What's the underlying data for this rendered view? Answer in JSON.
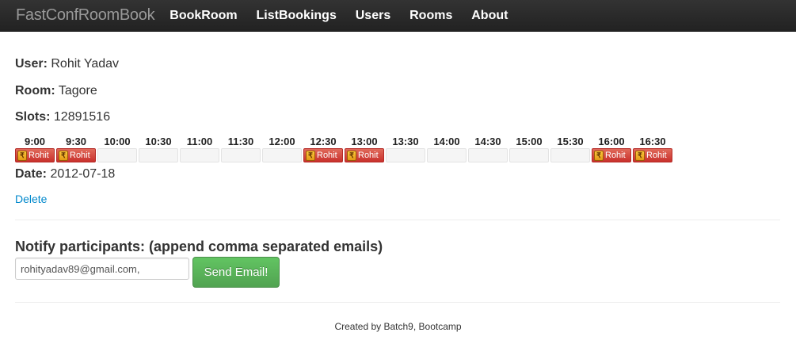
{
  "navbar": {
    "brand": "FastConfRoomBook",
    "items": [
      {
        "label": "BookRoom"
      },
      {
        "label": "ListBookings"
      },
      {
        "label": "Users"
      },
      {
        "label": "Rooms"
      },
      {
        "label": "About"
      }
    ]
  },
  "booking": {
    "user_label": "User:",
    "user_value": "Rohit Yadav",
    "room_label": "Room:",
    "room_value": "Tagore",
    "slots_label": "Slots:",
    "slots_value": "12891516",
    "date_label": "Date:",
    "date_value": "2012-07-18",
    "delete_label": "Delete"
  },
  "slots": [
    {
      "time": "9:00",
      "booked_by": "Rohit"
    },
    {
      "time": "9:30",
      "booked_by": "Rohit"
    },
    {
      "time": "10:00",
      "booked_by": ""
    },
    {
      "time": "10:30",
      "booked_by": ""
    },
    {
      "time": "11:00",
      "booked_by": ""
    },
    {
      "time": "11:30",
      "booked_by": ""
    },
    {
      "time": "12:00",
      "booked_by": ""
    },
    {
      "time": "12:30",
      "booked_by": "Rohit"
    },
    {
      "time": "13:00",
      "booked_by": "Rohit"
    },
    {
      "time": "13:30",
      "booked_by": ""
    },
    {
      "time": "14:00",
      "booked_by": ""
    },
    {
      "time": "14:30",
      "booked_by": ""
    },
    {
      "time": "15:00",
      "booked_by": ""
    },
    {
      "time": "15:30",
      "booked_by": ""
    },
    {
      "time": "16:00",
      "booked_by": "Rohit"
    },
    {
      "time": "16:30",
      "booked_by": "Rohit"
    }
  ],
  "notify": {
    "title": "Notify participants: (append comma separated emails)",
    "email_value": "rohityadav89@gmail.com,",
    "send_label": "Send Email!"
  },
  "footer": {
    "text": "Created by Batch9, Bootcamp"
  },
  "colors": {
    "navbar": "#222222",
    "link": "#0088cc",
    "booked": "#d9534f",
    "success": "#5bb75b"
  }
}
